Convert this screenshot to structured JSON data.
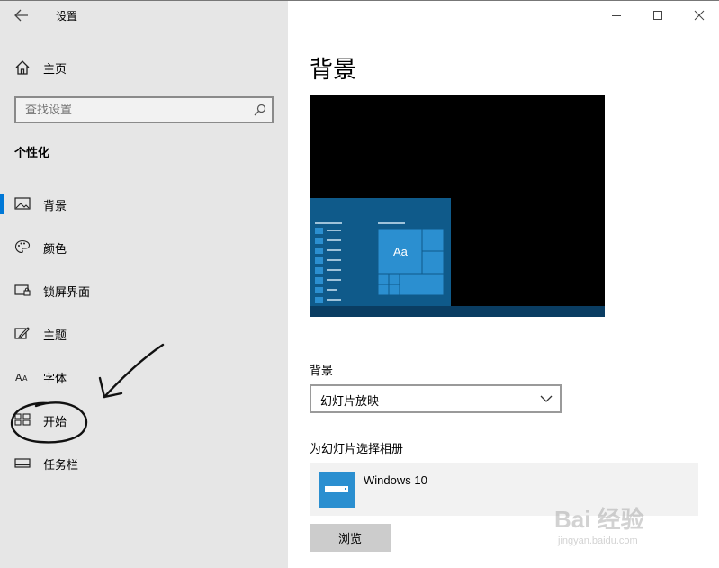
{
  "window": {
    "title": "设置",
    "controls": [
      "minimize-icon",
      "maximize-icon",
      "close-icon"
    ]
  },
  "sidebar": {
    "home_label": "主页",
    "search": {
      "placeholder": "查找设置"
    },
    "section_title": "个性化",
    "items": [
      {
        "label": "背景",
        "icon": "picture-icon",
        "selected": true
      },
      {
        "label": "颜色",
        "icon": "palette-icon",
        "selected": false
      },
      {
        "label": "锁屏界面",
        "icon": "lock-screen-icon",
        "selected": false
      },
      {
        "label": "主题",
        "icon": "theme-brush-icon",
        "selected": false
      },
      {
        "label": "字体",
        "icon": "font-icon",
        "selected": false
      },
      {
        "label": "开始",
        "icon": "start-tiles-icon",
        "selected": false
      },
      {
        "label": "任务栏",
        "icon": "taskbar-icon",
        "selected": false
      }
    ]
  },
  "main": {
    "title": "背景",
    "preview": {
      "tile_text": "Aa"
    },
    "background": {
      "label": "背景",
      "selected": "幻灯片放映"
    },
    "album": {
      "label": "为幻灯片选择相册",
      "name": "Windows 10"
    },
    "browse_label": "浏览"
  },
  "watermark": {
    "logo": "Bai 经验",
    "url": "jingyan.baidu.com"
  },
  "colors": {
    "accent": "#0078d7",
    "sidebar_bg": "#e6e6e6",
    "tile_blue": "#2b8fd0",
    "start_menu": "#0f5a8a"
  }
}
